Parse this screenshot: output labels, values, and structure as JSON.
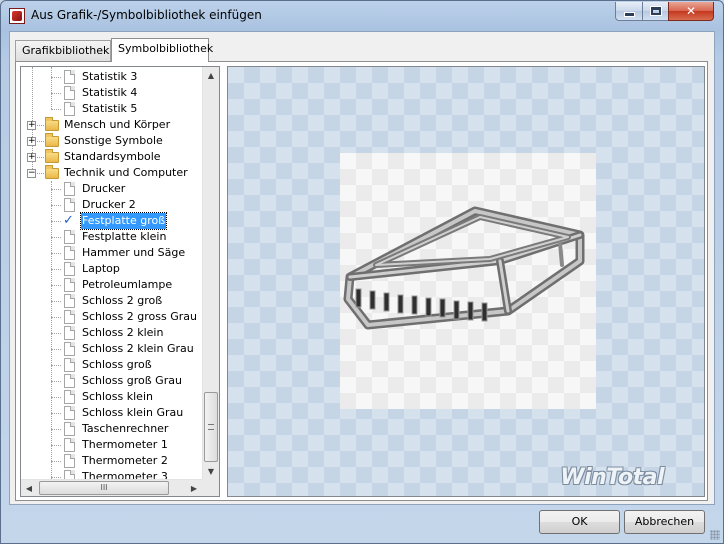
{
  "window": {
    "title": "Aus Grafik-/Symbolbibliothek einfügen"
  },
  "tabs": [
    {
      "label": "Grafikbibliothek",
      "active": false
    },
    {
      "label": "Symbolbibliothek",
      "active": true
    }
  ],
  "tree": {
    "items": [
      {
        "label": "Statistik 3",
        "kind": "document",
        "level": 2
      },
      {
        "label": "Statistik 4",
        "kind": "document",
        "level": 2
      },
      {
        "label": "Statistik 5",
        "kind": "document",
        "level": 2
      },
      {
        "label": "Mensch und Körper",
        "kind": "folder",
        "level": 1,
        "expander": "+"
      },
      {
        "label": "Sonstige Symbole",
        "kind": "folder",
        "level": 1,
        "expander": "+"
      },
      {
        "label": "Standardsymbole",
        "kind": "folder",
        "level": 1,
        "expander": "+"
      },
      {
        "label": "Technik und Computer",
        "kind": "folder",
        "level": 1,
        "expander": "−"
      },
      {
        "label": "Drucker",
        "kind": "document",
        "level": 2
      },
      {
        "label": "Drucker 2",
        "kind": "document",
        "level": 2
      },
      {
        "label": "Festplatte groß",
        "kind": "check",
        "level": 2,
        "selected": true
      },
      {
        "label": "Festplatte klein",
        "kind": "document",
        "level": 2
      },
      {
        "label": "Hammer und Säge",
        "kind": "document",
        "level": 2
      },
      {
        "label": "Laptop",
        "kind": "document",
        "level": 2
      },
      {
        "label": "Petroleumlampe",
        "kind": "document",
        "level": 2
      },
      {
        "label": "Schloss 2 groß",
        "kind": "document",
        "level": 2
      },
      {
        "label": "Schloss 2 gross Grau",
        "kind": "document",
        "level": 2
      },
      {
        "label": "Schloss 2 klein",
        "kind": "document",
        "level": 2
      },
      {
        "label": "Schloss 2 klein Grau",
        "kind": "document",
        "level": 2
      },
      {
        "label": "Schloss groß",
        "kind": "document",
        "level": 2
      },
      {
        "label": "Schloss groß Grau",
        "kind": "document",
        "level": 2
      },
      {
        "label": "Schloss klein",
        "kind": "document",
        "level": 2
      },
      {
        "label": "Schloss klein Grau",
        "kind": "document",
        "level": 2
      },
      {
        "label": "Taschenrechner",
        "kind": "document",
        "level": 2
      },
      {
        "label": "Thermometer 1",
        "kind": "document",
        "level": 2
      },
      {
        "label": "Thermometer 2",
        "kind": "document",
        "level": 2
      },
      {
        "label": "Thermometer 3",
        "kind": "document",
        "level": 2
      }
    ]
  },
  "preview": {
    "symbol": "hard-drive-icon",
    "watermark": "WinTotal"
  },
  "buttons": {
    "ok": "OK",
    "cancel": "Abbrechen"
  }
}
